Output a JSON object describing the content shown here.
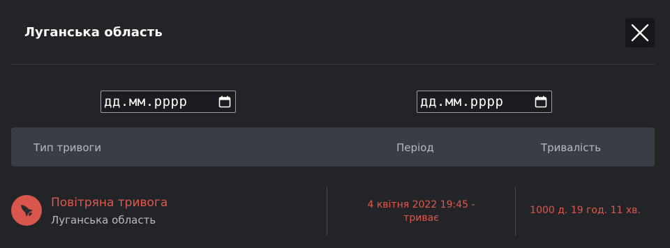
{
  "modal": {
    "title": "Луганська область",
    "close_icon": "close-icon"
  },
  "filters": {
    "date_from": {
      "placeholder": "дд.мм.рррр",
      "value": "",
      "icon": "calendar-icon"
    },
    "date_to": {
      "placeholder": "дд.мм.рррр",
      "value": "",
      "icon": "calendar-icon"
    }
  },
  "table": {
    "columns": [
      "Тип тривоги",
      "Період",
      "Тривалість"
    ],
    "rows": [
      {
        "icon": "rocket-icon",
        "alert_type": "Повітряна тривога",
        "region": "Луганська область",
        "period_line1": "4 квітня 2022 19:45 -",
        "period_line2": "триває",
        "duration": "1000 д. 19 год. 11 хв."
      }
    ]
  },
  "colors": {
    "background": "#232428",
    "header_row": "#3a3d43",
    "accent_red": "#e0584d",
    "icon_bg": "#d9564c"
  }
}
